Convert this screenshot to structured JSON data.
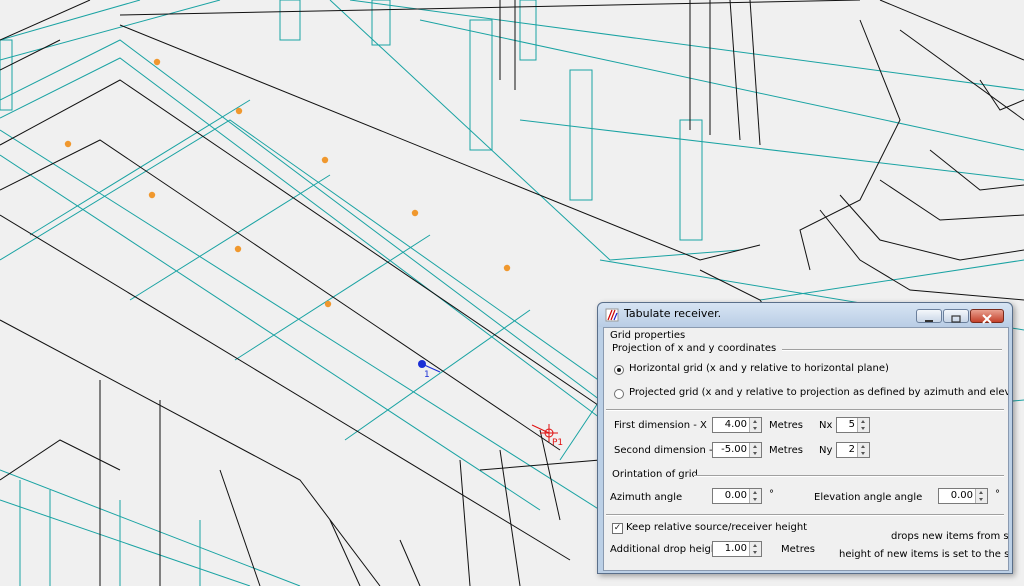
{
  "scene": {
    "markers": [
      {
        "label": "1",
        "color": "#1a2fd6"
      },
      {
        "label": "P1",
        "color": "#e01010"
      }
    ],
    "colors": {
      "wire_teal": "#1aa3a3",
      "wire_black": "#111111",
      "point_orange": "#f0982e"
    }
  },
  "dialog": {
    "title": "Tabulate receiver.",
    "minimize_icon": "minimize-icon",
    "restore_icon": "restore-icon",
    "close_icon": "close-icon",
    "grid_properties_label": "Grid properties",
    "projection_label": "Projection of x and y coordinates",
    "radio_horizontal": "Horizontal grid (x and y relative to horizontal plane)",
    "radio_projected": "Projected grid (x and y relative to projection as defined by azimuth and elevation)",
    "selected_projection": "horizontal",
    "first_dim_label": "First dimension - X",
    "first_dim_value": "4.00",
    "first_dim_unit": "Metres",
    "nx_label": "Nx",
    "nx_value": "5",
    "second_dim_label": "Second dimension - Y",
    "second_dim_value": "-5.00",
    "second_dim_unit": "Metres",
    "ny_label": "Ny",
    "ny_value": "2",
    "orientation_label": "Orintation of grid",
    "azimuth_label": "Azimuth angle",
    "azimuth_value": "0.00",
    "azimuth_unit": "°",
    "elevation_label": "Elevation angle angle",
    "elevation_value": "0.00",
    "elevation_unit": "°",
    "keep_height_label": "Keep relative source/receiver height",
    "keep_height_checked": true,
    "check_mark": "✓",
    "drop_height_label": "Additional drop height",
    "drop_height_value": "1.00",
    "drop_height_unit": "Metres",
    "note_drops": "drops new items from san",
    "note_height": "height of new items is set to the sam"
  }
}
